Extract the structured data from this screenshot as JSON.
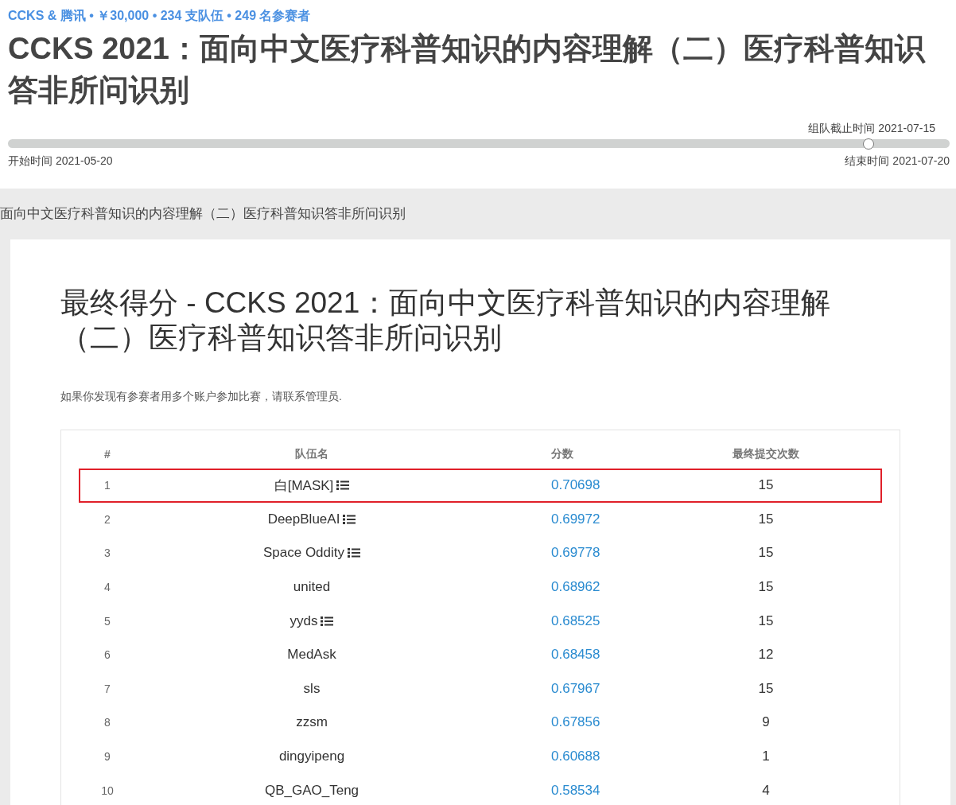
{
  "header": {
    "meta": "CCKS & 腾讯 • ￥30,000 • 234 支队伍 • 249 名参赛者",
    "title": "CCKS 2021：面向中文医疗科普知识的内容理解（二）医疗科普知识答非所问识别"
  },
  "timeline": {
    "level": 0.914,
    "milestone": "组队截止时间 2021-07-15",
    "start": "开始时间 2021-05-20",
    "end": "结束时间 2021-07-20"
  },
  "breadcrumb": "面向中文医疗科普知识的内容理解（二）医疗科普知识答非所问识别",
  "leaderboard": {
    "title": "最终得分 - CCKS 2021：面向中文医疗科普知识的内容理解（二）医疗科普知识答非所问识别",
    "note": "如果你发现有参赛者用多个账户参加比赛，请联系管理员.",
    "columns": [
      "#",
      "队伍名",
      "分数",
      "最终提交次数"
    ],
    "rows": [
      {
        "rank": "1",
        "team": "白[MASK]",
        "list_icon": true,
        "score": "0.70698",
        "submissions": "15",
        "highlighted": true
      },
      {
        "rank": "2",
        "team": "DeepBlueAI",
        "list_icon": true,
        "score": "0.69972",
        "submissions": "15",
        "highlighted": false
      },
      {
        "rank": "3",
        "team": "Space Oddity",
        "list_icon": true,
        "score": "0.69778",
        "submissions": "15",
        "highlighted": false
      },
      {
        "rank": "4",
        "team": "united",
        "list_icon": false,
        "score": "0.68962",
        "submissions": "15",
        "highlighted": false
      },
      {
        "rank": "5",
        "team": "yyds",
        "list_icon": true,
        "score": "0.68525",
        "submissions": "15",
        "highlighted": false
      },
      {
        "rank": "6",
        "team": "MedAsk",
        "list_icon": false,
        "score": "0.68458",
        "submissions": "12",
        "highlighted": false
      },
      {
        "rank": "7",
        "team": "sls",
        "list_icon": false,
        "score": "0.67967",
        "submissions": "15",
        "highlighted": false
      },
      {
        "rank": "8",
        "team": "zzsm",
        "list_icon": false,
        "score": "0.67856",
        "submissions": "9",
        "highlighted": false
      },
      {
        "rank": "9",
        "team": "dingyipeng",
        "list_icon": false,
        "score": "0.60688",
        "submissions": "1",
        "highlighted": false
      },
      {
        "rank": "10",
        "team": "QB_GAO_Teng",
        "list_icon": false,
        "score": "0.58534",
        "submissions": "4",
        "highlighted": false
      }
    ]
  }
}
